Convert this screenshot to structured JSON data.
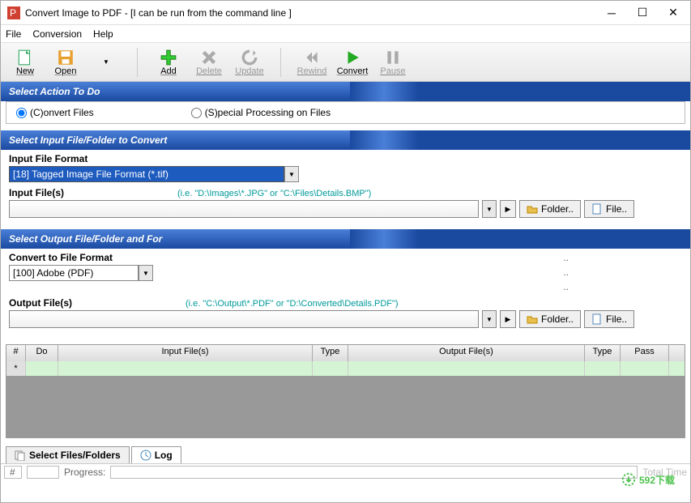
{
  "title": "Convert Image to PDF - [I can be run from the command line ]",
  "menubar": [
    "File",
    "Conversion",
    "Help"
  ],
  "toolbar": {
    "new": "New",
    "open": "Open",
    "add": "Add",
    "delete": "Delete",
    "update": "Update",
    "rewind": "Rewind",
    "convert": "Convert",
    "pause": "Pause"
  },
  "sections": {
    "action": "Select Action To Do",
    "input": "Select Input File/Folder to Convert",
    "output": "Select Output File/Folder and For"
  },
  "radios": {
    "convert": "(C)onvert Files",
    "special": "(S)pecial Processing on Files"
  },
  "input_section": {
    "format_label": "Input File Format",
    "format_value": "[18] Tagged Image File Format (*.tif)",
    "files_label": "Input File(s)",
    "hint": "(i.e. \"D:\\Images\\*.JPG\" or \"C:\\Files\\Details.BMP\")",
    "folder_btn": "Folder..",
    "file_btn": "File.."
  },
  "output_section": {
    "format_label": "Convert to File Format",
    "format_value": "[100] Adobe (PDF)",
    "files_label": "Output File(s)",
    "hint": "(i.e. \"C:\\Output\\*.PDF\" or \"D:\\Converted\\Details.PDF\")",
    "folder_btn": "Folder..",
    "file_btn": "File.."
  },
  "grid": {
    "cols": [
      "#",
      "Do",
      "Input File(s)",
      "Type",
      "Output File(s)",
      "Type",
      "Pass"
    ]
  },
  "tabs": {
    "select": "Select Files/Folders",
    "log": "Log"
  },
  "status": {
    "num": "#",
    "progress": "Progress:",
    "total": "Total Time"
  },
  "watermark": "592下载"
}
